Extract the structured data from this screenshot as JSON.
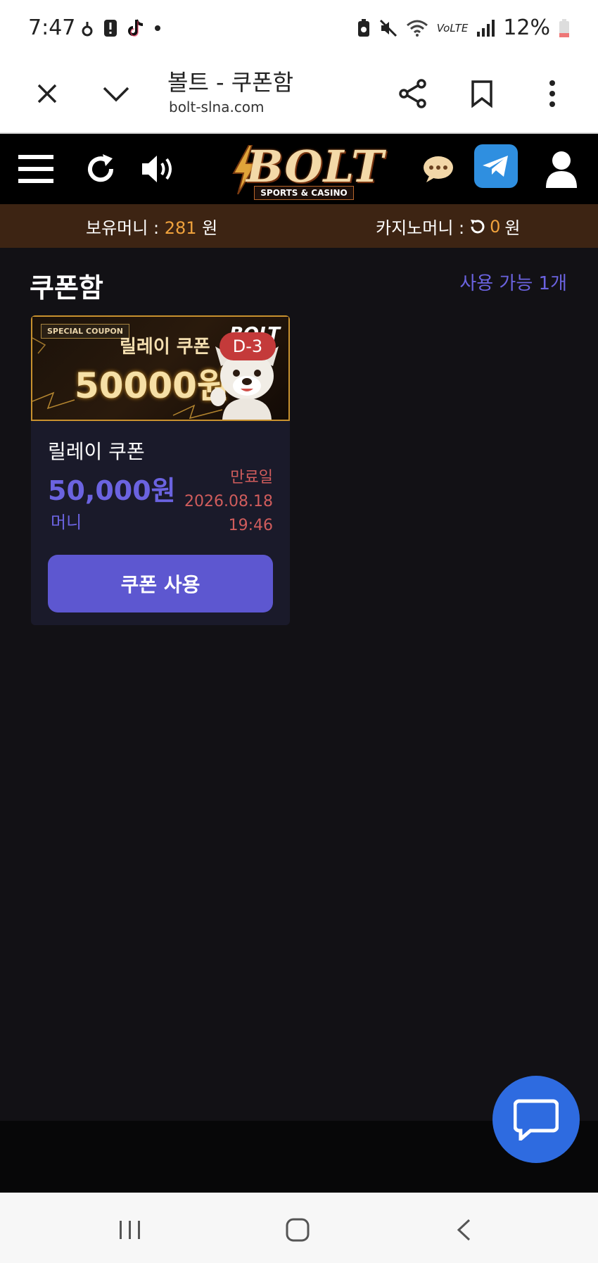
{
  "status": {
    "time": "7:47",
    "battery": "12%",
    "network": "VoLTE"
  },
  "browser": {
    "title": "볼트 - 쿠폰함",
    "url": "bolt-slna.com"
  },
  "site": {
    "logo_text": "BOLT",
    "logo_sub": "SPORTS & CASINO",
    "money_label": "보유머니 :",
    "money_value": "281",
    "money_unit": "원",
    "casino_label": "카지노머니 :",
    "casino_value": "0",
    "casino_unit": "원"
  },
  "page": {
    "heading": "쿠폰함",
    "available": "사용 가능 1개"
  },
  "coupon": {
    "banner_special": "SPECIAL COUPON",
    "banner_name": "릴레이 쿠폰",
    "banner_amount": "50000원",
    "banner_logo": "BOLT",
    "dday": "D-3",
    "name": "릴레이 쿠폰",
    "amount": "50,000원",
    "type": "머니",
    "expire_label": "만료일",
    "expire_date": "2026.08.18",
    "expire_time": "19:46",
    "use_button": "쿠폰 사용"
  },
  "colors": {
    "accent": "#5d57d0",
    "orange": "#f0a23c",
    "moneybar": "#3d2413",
    "chat": "#2e6be0",
    "danger": "#d05c5c"
  }
}
